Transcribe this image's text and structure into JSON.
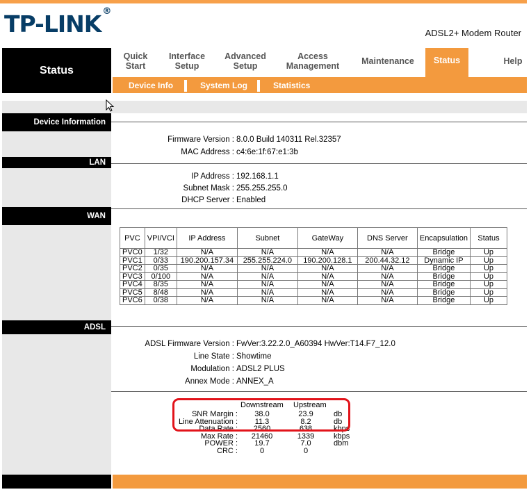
{
  "brand": {
    "logo": "TP-LINK",
    "reg": "®",
    "product": "ADSL2+ Modem Router"
  },
  "nav": {
    "section_title": "Status",
    "items": [
      {
        "l1": "Quick",
        "l2": "Start"
      },
      {
        "l1": "Interface",
        "l2": "Setup"
      },
      {
        "l1": "Advanced",
        "l2": "Setup"
      },
      {
        "l1": "Access",
        "l2": "Management"
      },
      {
        "l1": "Maintenance",
        "l2": ""
      },
      {
        "l1": "Status",
        "l2": ""
      },
      {
        "l1": "Help",
        "l2": ""
      }
    ],
    "subtabs": [
      "Device Info",
      "System Log",
      "Statistics"
    ]
  },
  "sections": {
    "device": "Device Information",
    "lan": "LAN",
    "wan": "WAN",
    "adsl": "ADSL"
  },
  "device": {
    "firmware_label": "Firmware Version :",
    "firmware": "8.0.0 Build 140311 Rel.32357",
    "mac_label": "MAC Address :",
    "mac": "c4:6e:1f:67:e1:3b"
  },
  "lan": {
    "ip_label": "IP Address :",
    "ip": "192.168.1.1",
    "mask_label": "Subnet Mask :",
    "mask": "255.255.255.0",
    "dhcp_label": "DHCP Server :",
    "dhcp": "Enabled"
  },
  "wan": {
    "headers": [
      "PVC",
      "VPI/VCI",
      "IP Address",
      "Subnet",
      "GateWay",
      "DNS Server",
      "Encapsulation",
      "Status"
    ],
    "rows": [
      [
        "PVC0",
        "1/32",
        "N/A",
        "N/A",
        "N/A",
        "N/A",
        "Bridge",
        "Up"
      ],
      [
        "PVC1",
        "0/33",
        "190.200.157.34",
        "255.255.224.0",
        "190.200.128.1",
        "200.44.32.12",
        "Dynamic IP",
        "Up"
      ],
      [
        "PVC2",
        "0/35",
        "N/A",
        "N/A",
        "N/A",
        "N/A",
        "Bridge",
        "Up"
      ],
      [
        "PVC3",
        "0/100",
        "N/A",
        "N/A",
        "N/A",
        "N/A",
        "Bridge",
        "Up"
      ],
      [
        "PVC4",
        "8/35",
        "N/A",
        "N/A",
        "N/A",
        "N/A",
        "Bridge",
        "Up"
      ],
      [
        "PVC5",
        "8/48",
        "N/A",
        "N/A",
        "N/A",
        "N/A",
        "Bridge",
        "Up"
      ],
      [
        "PVC6",
        "0/38",
        "N/A",
        "N/A",
        "N/A",
        "N/A",
        "Bridge",
        "Up"
      ]
    ]
  },
  "adsl": {
    "fw_label": "ADSL Firmware Version :",
    "fw": "FwVer:3.22.2.0_A60394 HwVer:T14.F7_12.0",
    "state_label": "Line State :",
    "state": "Showtime",
    "mod_label": "Modulation :",
    "mod": "ADSL2 PLUS",
    "annex_label": "Annex Mode :",
    "annex": "ANNEX_A",
    "col_down": "Downstream",
    "col_up": "Upstream",
    "stats": [
      {
        "label": "SNR Margin :",
        "down": "38.0",
        "up": "23.9",
        "unit": "db"
      },
      {
        "label": "Line Attenuation :",
        "down": "11.3",
        "up": "8.2",
        "unit": "db"
      },
      {
        "label": "Data Rate :",
        "down": "2560",
        "up": "638",
        "unit": "kbps"
      },
      {
        "label": "Max Rate :",
        "down": "21460",
        "up": "1339",
        "unit": "kbps"
      },
      {
        "label": "POWER :",
        "down": "19.7",
        "up": "7.0",
        "unit": "dbm"
      },
      {
        "label": "CRC :",
        "down": "0",
        "up": "0",
        "unit": ""
      }
    ]
  }
}
